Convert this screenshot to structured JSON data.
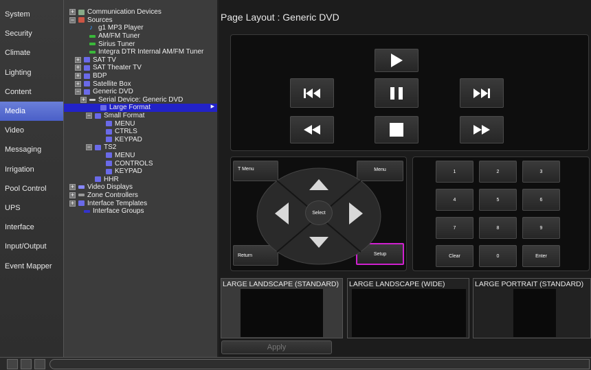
{
  "nav": {
    "items": [
      "System",
      "Security",
      "Climate",
      "Lighting",
      "Content",
      "Media",
      "Video",
      "Messaging",
      "Irrigation",
      "Pool Control",
      "UPS",
      "Interface",
      "Input/Output",
      "Event Mapper"
    ],
    "active": "Media"
  },
  "tree": {
    "rows": [
      {
        "text": "Communication Devices",
        "tog": "+",
        "icon": "comm",
        "indent": 0
      },
      {
        "text": "Sources",
        "tog": "−",
        "icon": "folder",
        "indent": 0
      },
      {
        "text": "g1 MP3 Player",
        "tog": "",
        "icon": "note",
        "indent": 1
      },
      {
        "text": "AM/FM Tuner",
        "tog": "",
        "icon": "green",
        "indent": 1
      },
      {
        "text": "Sirius Tuner",
        "tog": "",
        "icon": "green",
        "indent": 1
      },
      {
        "text": "Integra DTR Internal AM/FM Tuner",
        "tog": "",
        "icon": "green",
        "indent": 1
      },
      {
        "text": "SAT TV",
        "tog": "+",
        "icon": "doc",
        "indent": 0.5
      },
      {
        "text": "SAT Theater TV",
        "tog": "+",
        "icon": "doc",
        "indent": 0.5
      },
      {
        "text": "BDP",
        "tog": "+",
        "icon": "doc",
        "indent": 0.5
      },
      {
        "text": "Satellite Box",
        "tog": "+",
        "icon": "doc",
        "indent": 0.5
      },
      {
        "text": "Generic DVD",
        "tog": "−",
        "icon": "doc",
        "indent": 0.5
      },
      {
        "text": "Serial Device: Generic DVD",
        "tog": "+",
        "icon": "ser",
        "indent": 1
      },
      {
        "text": "Large Format",
        "tog": "",
        "icon": "doc",
        "indent": 2,
        "selected": true
      },
      {
        "text": "Small Format",
        "tog": "−",
        "icon": "doc",
        "indent": 1.5
      },
      {
        "text": "MENU",
        "tog": "",
        "icon": "doc",
        "indent": 2.5
      },
      {
        "text": "CTRLS",
        "tog": "",
        "icon": "doc",
        "indent": 2.5
      },
      {
        "text": "KEYPAD",
        "tog": "",
        "icon": "doc",
        "indent": 2.5
      },
      {
        "text": "TS2",
        "tog": "−",
        "icon": "doc",
        "indent": 1.5
      },
      {
        "text": "MENU",
        "tog": "",
        "icon": "doc",
        "indent": 2.5
      },
      {
        "text": "CONTROLS",
        "tog": "",
        "icon": "doc",
        "indent": 2.5
      },
      {
        "text": "KEYPAD",
        "tog": "",
        "icon": "doc",
        "indent": 2.5
      },
      {
        "text": "HHR",
        "tog": "",
        "icon": "doc",
        "indent": 1.5
      },
      {
        "text": "Video Displays",
        "tog": "+",
        "icon": "disp",
        "indent": 0
      },
      {
        "text": "Zone Controllers",
        "tog": "+",
        "icon": "zone",
        "indent": 0
      },
      {
        "text": "Interface Templates",
        "tog": "+",
        "icon": "doc",
        "indent": 0
      },
      {
        "text": "Interface Groups",
        "tog": "",
        "icon": "grp",
        "indent": 0.5
      }
    ]
  },
  "main": {
    "title": "Page Layout : Generic DVD",
    "remote": {
      "t_menu": "T Menu",
      "menu": "Menu",
      "select": "Select",
      "return": "Return",
      "setup": "Setup"
    },
    "keypad": [
      "1",
      "2",
      "3",
      "4",
      "5",
      "6",
      "7",
      "8",
      "9",
      "Clear",
      "0",
      "Enter"
    ],
    "thumbnails": [
      "LARGE LANDSCAPE (STANDARD)",
      "LARGE LANDSCAPE (WIDE)",
      "LARGE PORTRAIT (STANDARD)"
    ],
    "apply_label": "Apply"
  },
  "colors": {
    "nav_active": "#5a6fd0",
    "tree_selected": "#2222c8",
    "setup_highlight": "#d020d0"
  }
}
